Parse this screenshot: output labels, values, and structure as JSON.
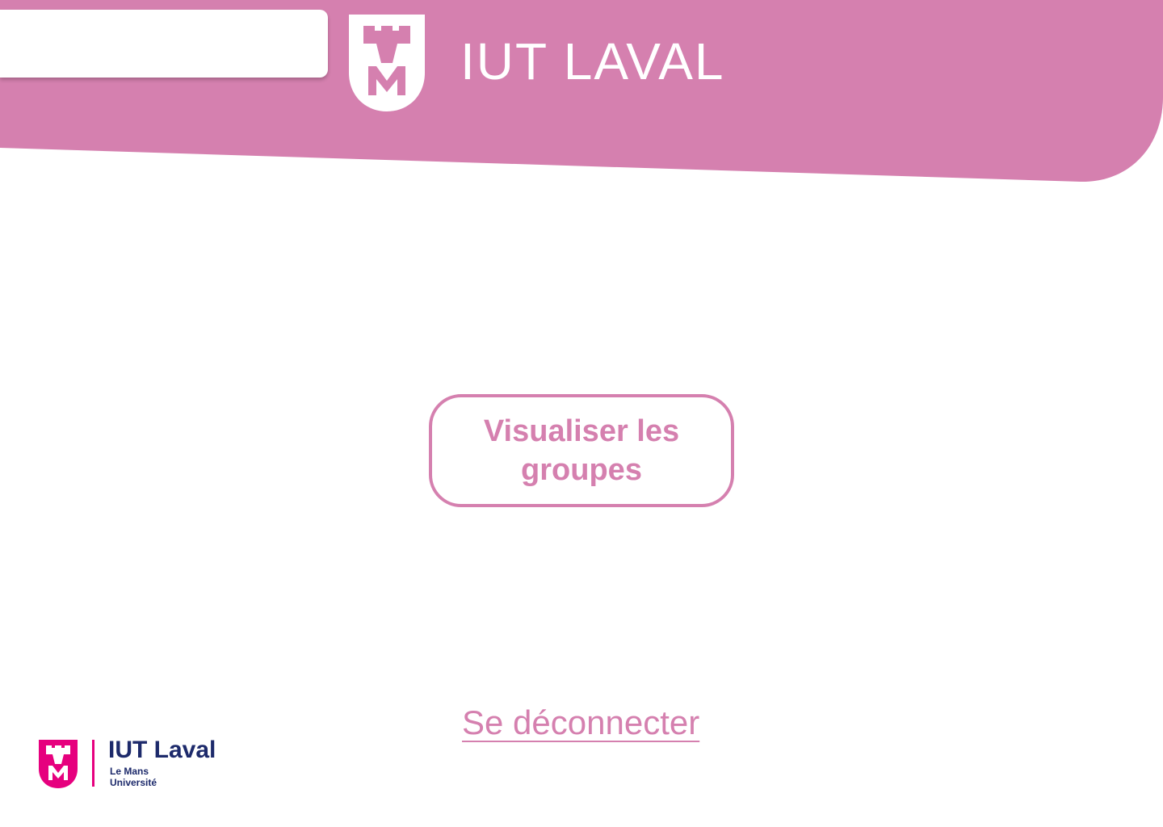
{
  "header": {
    "title": "IUT LAVAL",
    "search_value": "",
    "background_color": "#d580af"
  },
  "main": {
    "groups_button_label": "Visualiser les groupes",
    "accent_color": "#d580af"
  },
  "footer": {
    "logout_label": "Se déconnecter",
    "logo_name": "IUT Laval",
    "logo_sub_line1": "Le Mans",
    "logo_sub_line2": "Université",
    "logo_shield_color": "#e6007e",
    "logo_text_color": "#1d2a6b"
  },
  "icons": {
    "header_logo": "tower-m-shield-icon",
    "footer_logo": "tower-m-shield-icon"
  }
}
